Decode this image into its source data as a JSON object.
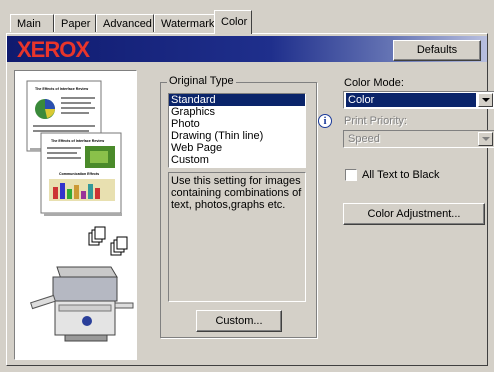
{
  "tabs": [
    {
      "label": "Main"
    },
    {
      "label": "Paper"
    },
    {
      "label": "Advanced"
    },
    {
      "label": "Watermarks"
    },
    {
      "label": "Color",
      "active": true
    }
  ],
  "banner": {
    "logo_text": "XEROX",
    "defaults_label": "Defaults",
    "logo_color": "#e8352b"
  },
  "original_type": {
    "label": "Original Type",
    "options": [
      "Standard",
      "Graphics",
      "Photo",
      "Drawing (Thin line)",
      "Web Page",
      "Custom"
    ],
    "selected": "Standard",
    "description": "Use this setting for images containing combinations of text, photos,graphs etc.",
    "custom_button": "Custom..."
  },
  "color_mode": {
    "label": "Color Mode:",
    "value": "Color"
  },
  "print_priority": {
    "label": "Print Priority:",
    "value": "Speed",
    "disabled": true
  },
  "all_text_black": {
    "label": "All Text to Black",
    "checked": false
  },
  "color_adjustment": {
    "label": "Color Adjustment..."
  },
  "preview": {
    "doc1_title": "The Effects of Interface Review",
    "doc2_title": "The Effects of Interface Review",
    "doc2_subtitle": "Communication Effects"
  },
  "colors": {
    "selection": "#0a246a",
    "dialog_bg": "#d4d0c8"
  }
}
